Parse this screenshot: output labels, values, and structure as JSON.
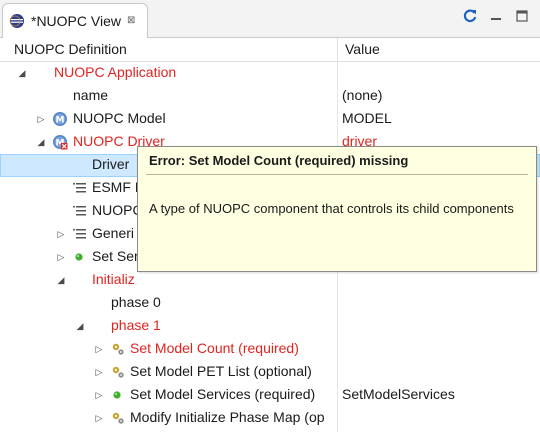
{
  "tab": {
    "title": "*NUOPC View",
    "close": "⊠"
  },
  "toolbar": {
    "refresh_icon": "refresh-icon",
    "minimize_icon": "minimize-icon",
    "maximize_icon": "maximize-icon"
  },
  "columns": {
    "definition": "NUOPC Definition",
    "value": "Value"
  },
  "colors": {
    "error_text": "#e12420",
    "selection": "#cde8ff",
    "tooltip_bg": "#ffffe1"
  },
  "rows": [
    {
      "label": "NUOPC Application",
      "value": ""
    },
    {
      "label": "name",
      "value": "(none)"
    },
    {
      "label": "NUOPC Model",
      "value": "MODEL"
    },
    {
      "label": "NUOPC Driver",
      "value": "driver"
    },
    {
      "label": "Driver",
      "value": ""
    },
    {
      "label": "ESMF I",
      "value": ""
    },
    {
      "label": "NUOPC",
      "value": ""
    },
    {
      "label": "Generi",
      "value": ""
    },
    {
      "label": "Set Ser",
      "value": ""
    },
    {
      "label": "Initializ",
      "value": ""
    },
    {
      "label": "phase 0",
      "value": ""
    },
    {
      "label": "phase 1",
      "value": ""
    },
    {
      "label": "Set Model Count (required)",
      "value": ""
    },
    {
      "label": "Set Model PET List (optional)",
      "value": ""
    },
    {
      "label": "Set Model Services (required)",
      "value": "SetModelServices"
    },
    {
      "label": "Modify Initialize Phase Map (op",
      "value": ""
    }
  ],
  "tooltip": {
    "title": "Error: Set Model Count (required) missing",
    "body": "A type of NUOPC component that controls its child components"
  }
}
